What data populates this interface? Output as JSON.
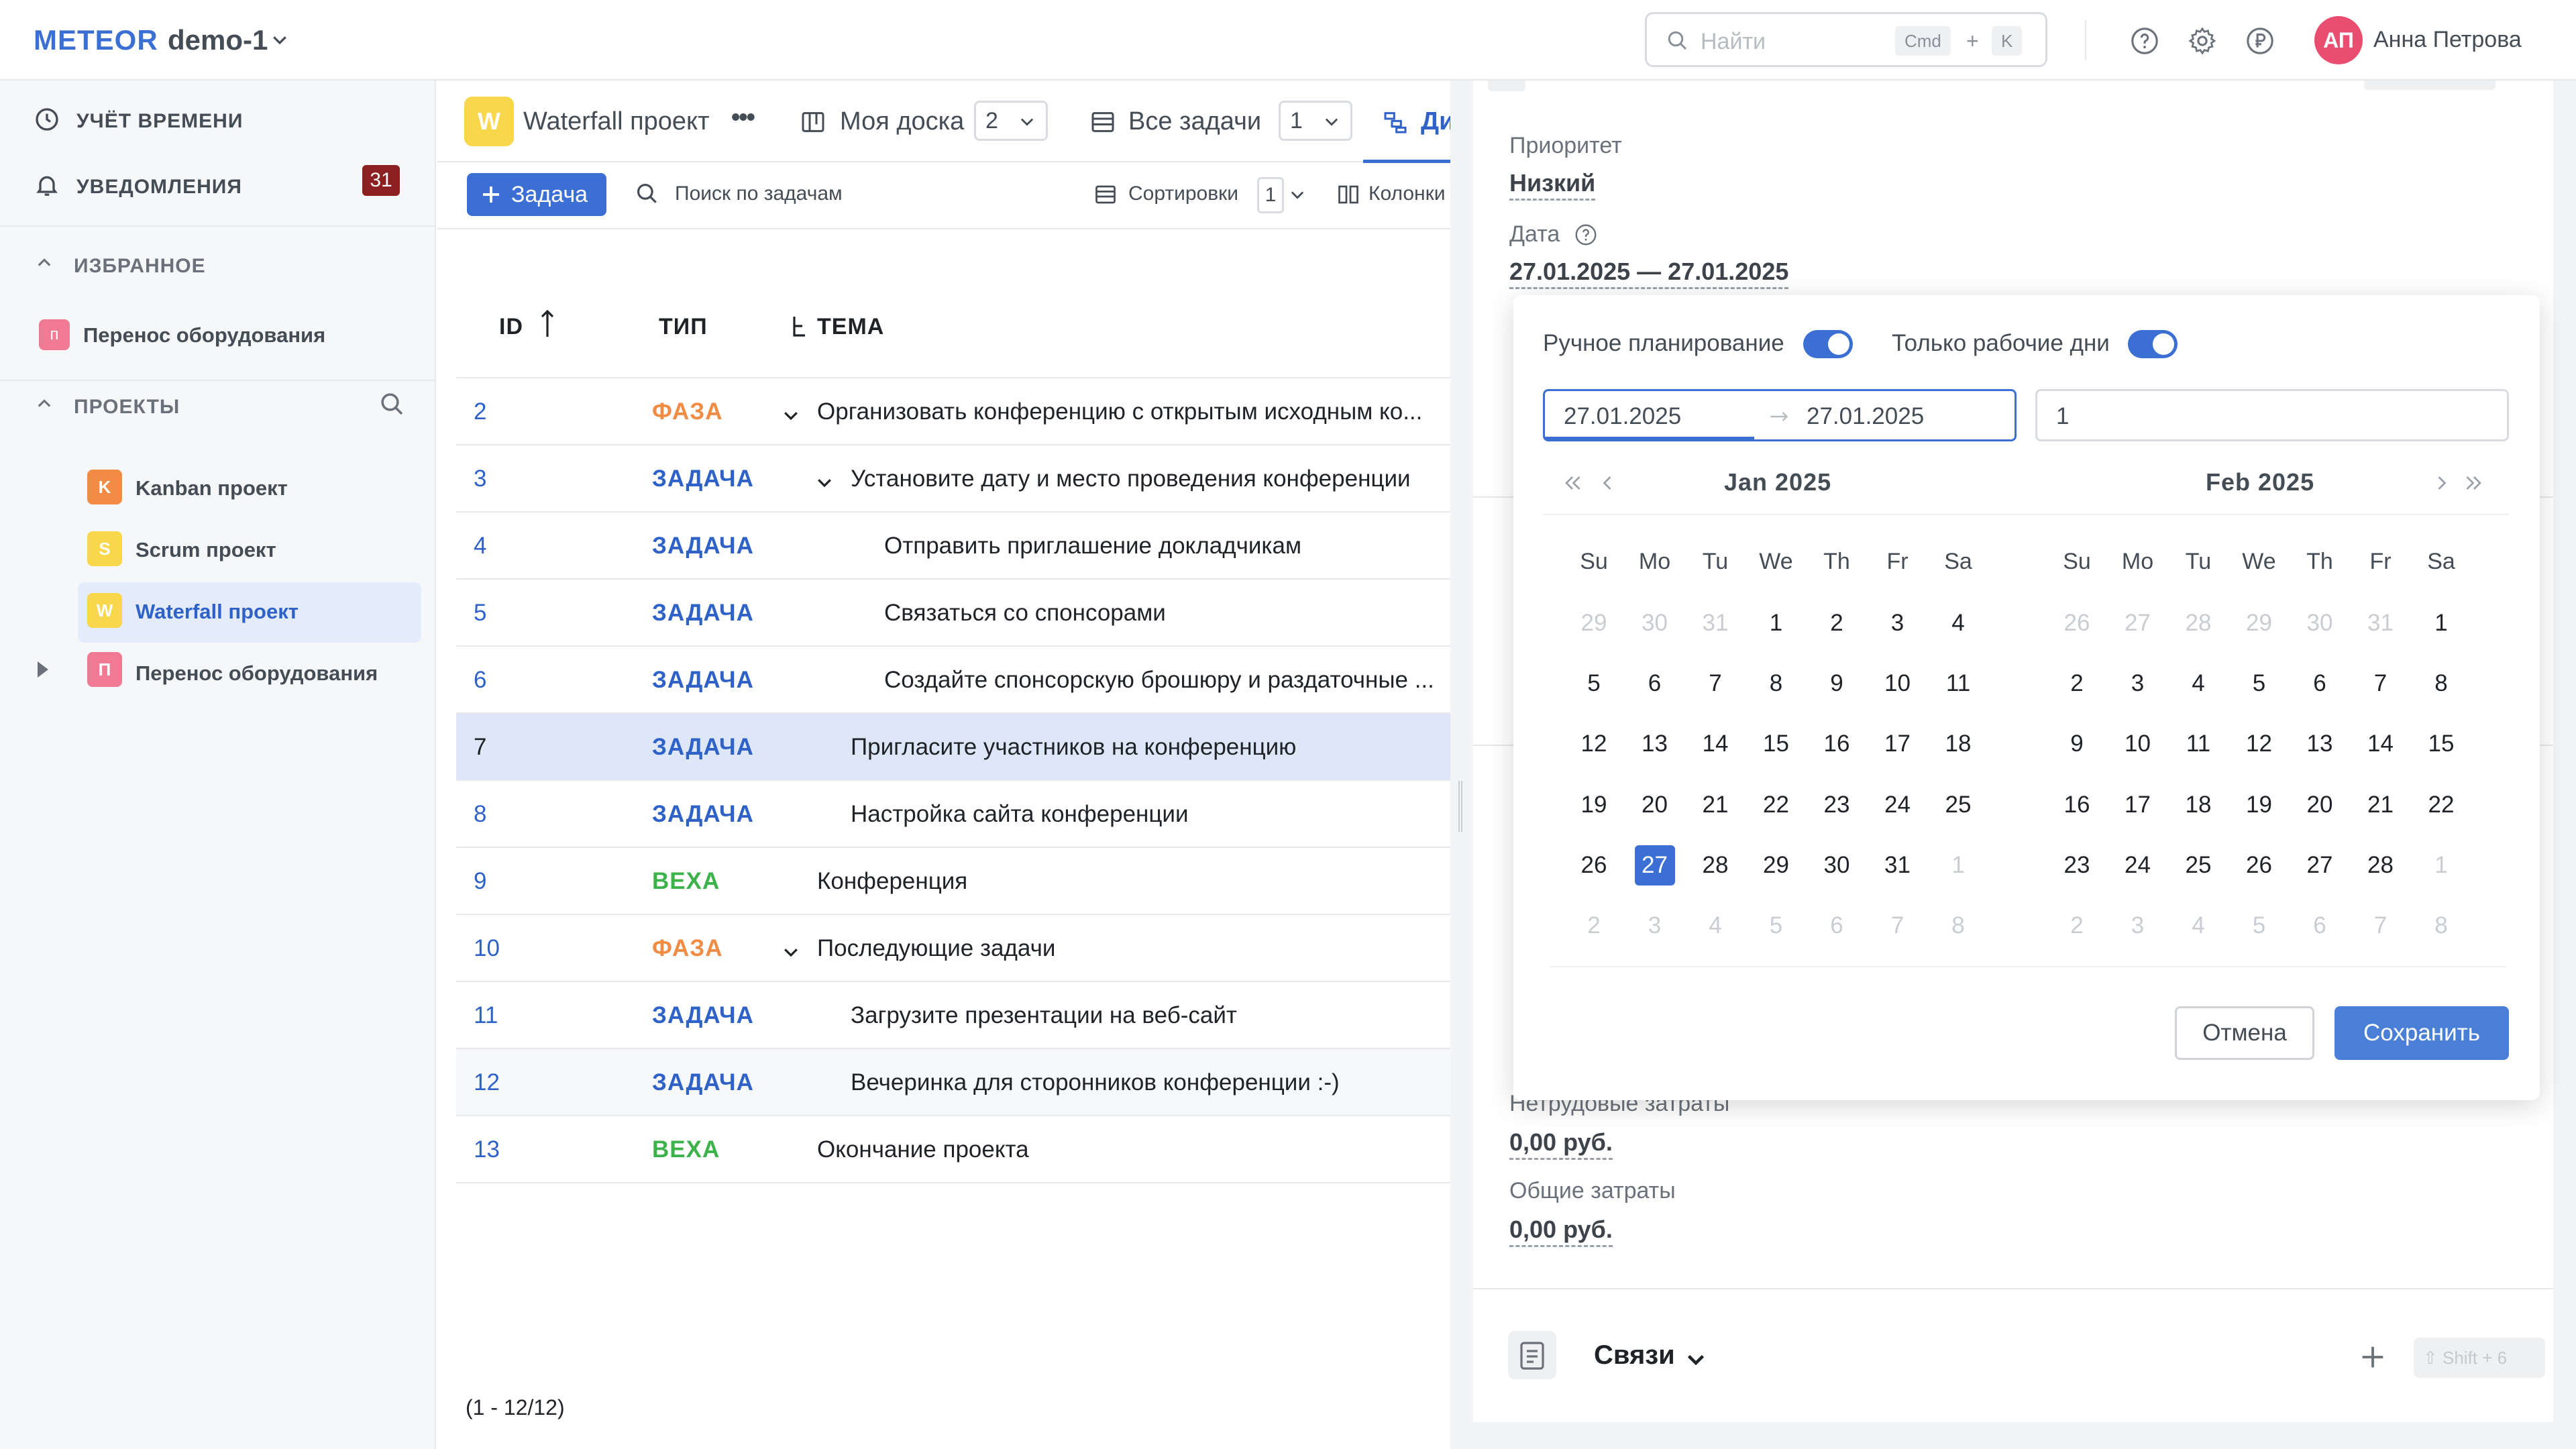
{
  "topbar": {
    "logo": "METEOR",
    "workspace": "demo-1",
    "search_placeholder": "Найти",
    "kbd_cmd": "Cmd",
    "kbd_plus": "+",
    "kbd_k": "K",
    "avatar_initials": "АП",
    "user_name": "Анна Петрова"
  },
  "sidebar": {
    "time_tracking": "УЧЁТ ВРЕМЕНИ",
    "notifications": "УВЕДОМЛЕНИЯ",
    "notifications_count": "31",
    "favorites_header": "ИЗБРАННОЕ",
    "favorite_item": {
      "letter": "п",
      "name": "Перенос оборудования"
    },
    "projects_header": "ПРОЕКТЫ",
    "projects": [
      {
        "letter": "K",
        "name": "Kanban проект",
        "color": "#f28b44"
      },
      {
        "letter": "S",
        "name": "Scrum проект",
        "color": "#f9d74a"
      },
      {
        "letter": "W",
        "name": "Waterfall проект",
        "color": "#f9d74a"
      },
      {
        "letter": "П",
        "name": "Перенос оборудования",
        "color": "#f07a93"
      }
    ]
  },
  "main": {
    "project_letter": "W",
    "project_name": "Waterfall проект",
    "more": "•••",
    "tabs": [
      {
        "label": "Моя доска",
        "count": "2"
      },
      {
        "label": "Все задачи",
        "count": "1"
      },
      {
        "label": "Ди"
      }
    ],
    "add_task": "Задача",
    "search_tasks": "Поиск по задачам",
    "sort_label": "Сортировки",
    "sort_count": "1",
    "columns_label": "Колонки",
    "headers": {
      "id": "ID",
      "type": "ТИП",
      "subject": "ТЕМА"
    },
    "rows": [
      {
        "id": "2",
        "type": "ФАЗА",
        "subject": "Организовать конференцию с открытым исходным ко..."
      },
      {
        "id": "3",
        "type": "ЗАДАЧА",
        "subject": "Установите дату и место проведения конференции"
      },
      {
        "id": "4",
        "type": "ЗАДАЧА",
        "subject": "Отправить приглашение докладчикам"
      },
      {
        "id": "5",
        "type": "ЗАДАЧА",
        "subject": "Связаться со спонсорами"
      },
      {
        "id": "6",
        "type": "ЗАДАЧА",
        "subject": "Создайте спонсорскую брошюру и раздаточные ..."
      },
      {
        "id": "7",
        "type": "ЗАДАЧА",
        "subject": "Пригласите участников на конференцию"
      },
      {
        "id": "8",
        "type": "ЗАДАЧА",
        "subject": "Настройка сайта конференции"
      },
      {
        "id": "9",
        "type": "ВЕХА",
        "subject": "Конференция"
      },
      {
        "id": "10",
        "type": "ФАЗА",
        "subject": "Последующие задачи"
      },
      {
        "id": "11",
        "type": "ЗАДАЧА",
        "subject": "Загрузите презентации на веб-сайт"
      },
      {
        "id": "12",
        "type": "ЗАДАЧА",
        "subject": "Вечеринка для сторонников конференции :-)"
      },
      {
        "id": "13",
        "type": "ВЕХА",
        "subject": "Окончание проекта"
      }
    ],
    "type_colors": {
      "ФАЗА": "#f28b44",
      "ЗАДАЧА": "#2f62c8",
      "ВЕХА": "#3bb24a"
    },
    "pager": "(1 - 12/12)"
  },
  "panel": {
    "priority_label": "Приоритет",
    "priority_value": "Низкий",
    "date_label": "Дата",
    "date_value": "27.01.2025 — 27.01.2025",
    "nonlabor_label": "Нетрудовые затраты",
    "nonlabor_value": "0,00 руб.",
    "total_label": "Общие затраты",
    "total_value": "0,00 руб.",
    "links_title": "Связи",
    "links_shortcut": "⇧ Shift + 6"
  },
  "datepicker": {
    "manual_planning": "Ручное планирование",
    "workdays_only": "Только рабочие дни",
    "from": "27.01.2025",
    "to": "27.01.2025",
    "days": "1",
    "weekdays": [
      "Su",
      "Mo",
      "Tu",
      "We",
      "Th",
      "Fr",
      "Sa"
    ],
    "months": [
      {
        "title": "Jan  2025",
        "weeks": [
          [
            "29",
            "30",
            "31",
            "1",
            "2",
            "3",
            "4"
          ],
          [
            "5",
            "6",
            "7",
            "8",
            "9",
            "10",
            "11"
          ],
          [
            "12",
            "13",
            "14",
            "15",
            "16",
            "17",
            "18"
          ],
          [
            "19",
            "20",
            "21",
            "22",
            "23",
            "24",
            "25"
          ],
          [
            "26",
            "27",
            "28",
            "29",
            "30",
            "31",
            "1"
          ],
          [
            "2",
            "3",
            "4",
            "5",
            "6",
            "7",
            "8"
          ]
        ],
        "first_current_index": 3,
        "last_current_index": 33,
        "selected": "27"
      },
      {
        "title": "Feb  2025",
        "weeks": [
          [
            "26",
            "27",
            "28",
            "29",
            "30",
            "31",
            "1"
          ],
          [
            "2",
            "3",
            "4",
            "5",
            "6",
            "7",
            "8"
          ],
          [
            "9",
            "10",
            "11",
            "12",
            "13",
            "14",
            "15"
          ],
          [
            "16",
            "17",
            "18",
            "19",
            "20",
            "21",
            "22"
          ],
          [
            "23",
            "24",
            "25",
            "26",
            "27",
            "28",
            "1"
          ],
          [
            "2",
            "3",
            "4",
            "5",
            "6",
            "7",
            "8"
          ]
        ],
        "first_current_index": 6,
        "last_current_index": 33,
        "selected": ""
      }
    ],
    "cancel": "Отмена",
    "save": "Сохранить"
  }
}
